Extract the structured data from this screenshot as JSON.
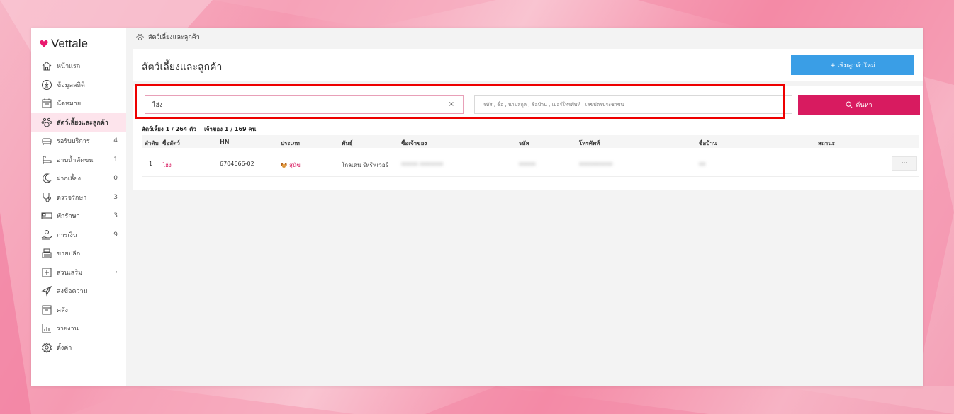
{
  "app": {
    "name": "Vettale",
    "brand_color": "#e9196e",
    "accent_color": "#3a9ee6",
    "primary_color": "#d81b60"
  },
  "sidebar": {
    "items": [
      {
        "label": "หน้าแรก",
        "icon": "home-icon",
        "badge": ""
      },
      {
        "label": "ข้อมูลสถิติ",
        "icon": "stats-icon",
        "badge": ""
      },
      {
        "label": "นัดหมาย",
        "icon": "calendar-icon",
        "badge": ""
      },
      {
        "label": "สัตว์เลี้ยงและลูกค้า",
        "icon": "paw-icon",
        "badge": "",
        "active": true
      },
      {
        "label": "รอรับบริการ",
        "icon": "sofa-icon",
        "badge": "4"
      },
      {
        "label": "อาบน้ำตัดขน",
        "icon": "bath-icon",
        "badge": "1"
      },
      {
        "label": "ฝากเลี้ยง",
        "icon": "moon-icon",
        "badge": "0"
      },
      {
        "label": "ตรวจรักษา",
        "icon": "stethoscope-icon",
        "badge": "3"
      },
      {
        "label": "พักรักษา",
        "icon": "bed-icon",
        "badge": "3"
      },
      {
        "label": "การเงิน",
        "icon": "money-hand-icon",
        "badge": "9"
      },
      {
        "label": "ขายปลีก",
        "icon": "cash-register-icon",
        "badge": ""
      },
      {
        "label": "ส่วนเสริม",
        "icon": "plus-square-icon",
        "badge": "›"
      },
      {
        "label": "ส่งข้อความ",
        "icon": "send-icon",
        "badge": ""
      },
      {
        "label": "คลัง",
        "icon": "inventory-icon",
        "badge": ""
      },
      {
        "label": "รายงาน",
        "icon": "chart-icon",
        "badge": ""
      },
      {
        "label": "ตั้งค่า",
        "icon": "gear-icon",
        "badge": ""
      }
    ]
  },
  "breadcrumb": {
    "label": "สัตว์เลี้ยงและลูกค้า"
  },
  "header": {
    "title": "สัตว์เลี้ยงและลูกค้า",
    "add_label": "+ เพิ่มลูกค้าใหม่"
  },
  "search": {
    "value": "ไฮ่ง",
    "clear": "×",
    "detail_placeholder": "รหัส , ชื่อ , นามสกุล , ชื่อบ้าน , เบอร์โทรศัพท์ , เลขบัตรประชาชน",
    "button_label": "ค้นหา"
  },
  "summary": "สัตว์เลี้ยง 1 / 264 ตัว    เจ้าของ 1 / 169 คน",
  "table": {
    "headers": [
      "ลำดับ",
      "ชื่อสัตว์",
      "HN",
      "ประเภท",
      "พันธุ์",
      "ชื่อเจ้าของ",
      "รหัส",
      "โทรศัพท์",
      "ชื่อบ้าน",
      "สถานะ"
    ],
    "rows": [
      {
        "index": "1",
        "pet_name": "ไฮ่ง",
        "hn": "6704666-02",
        "type_icon": "dog-icon",
        "type": "สุนัข",
        "breed": "โกลเดน รีทรีฟเวอร์",
        "owner": "xxxxx xxxxxxx",
        "code": "xxxxx",
        "phone": "xxxxxxxxxx",
        "house": "xx",
        "more": "···"
      }
    ]
  }
}
